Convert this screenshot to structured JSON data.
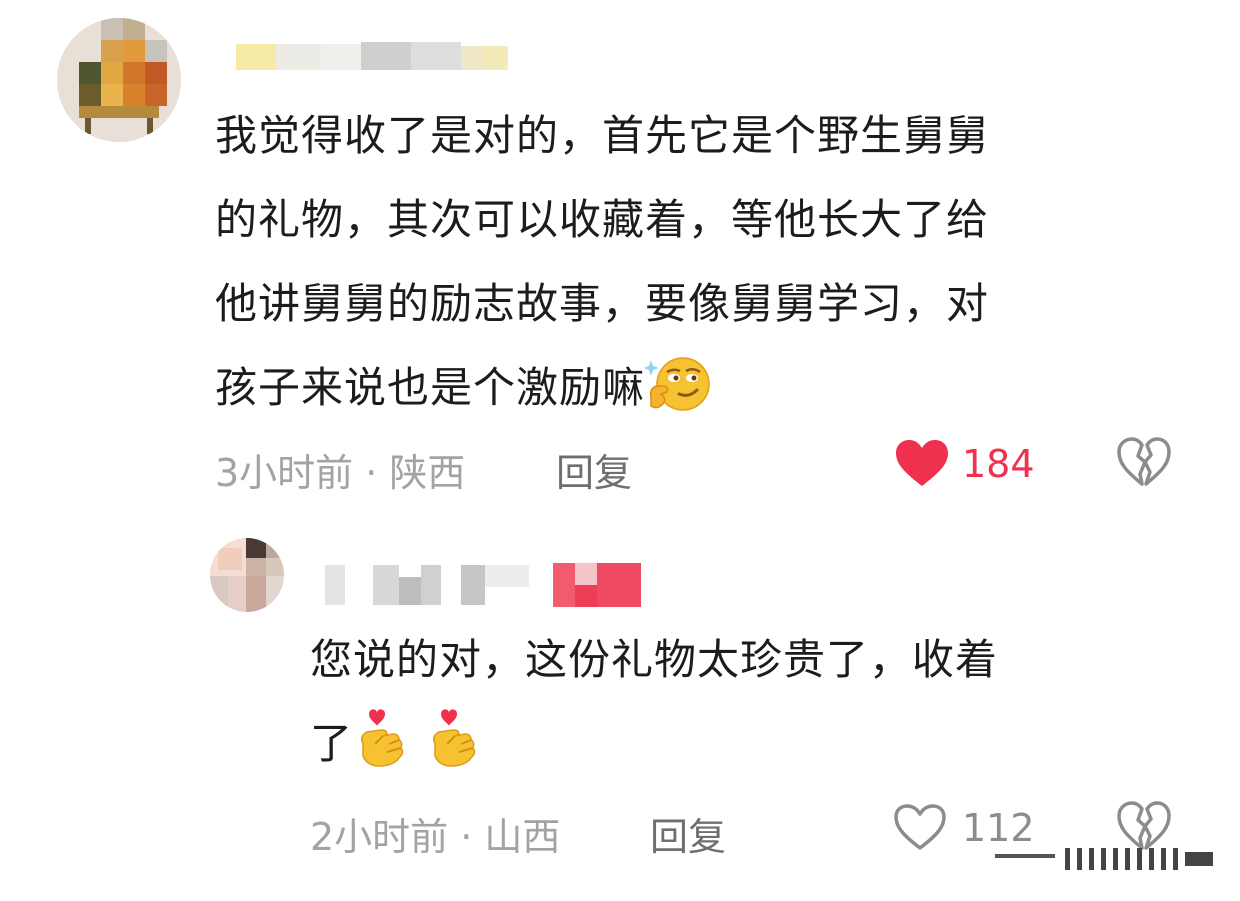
{
  "colors": {
    "text": "#1c1c1c",
    "meta": "#a3a3a3",
    "reply": "#6f6f6f",
    "liked": "#f0304f",
    "icon_gray": "#8c8c8c"
  },
  "main_comment": {
    "text": "我觉得收了是对的，首先它是个野生舅舅\n的礼物，其次可以收藏着，等他长大了给\n他讲舅舅的励志故事，要像舅舅学习，对\n孩子来说也是个激励嘛",
    "emoji": "thinking-hand-smirk-emoji",
    "time_location": "3小时前 · 陕西",
    "reply_label": "回复",
    "likes": "184",
    "liked": true,
    "like_icon": "heart-filled-icon",
    "dislike_icon": "broken-heart-icon"
  },
  "reply_comment": {
    "text": "您说的对，这份礼物太珍贵了，收着\n了",
    "emojis": [
      "finger-heart-emoji",
      "finger-heart-emoji"
    ],
    "time_location": "2小时前 · 山西",
    "reply_label": "回复",
    "likes": "112",
    "liked": false,
    "like_icon": "heart-outline-icon",
    "dislike_icon": "broken-heart-icon"
  }
}
